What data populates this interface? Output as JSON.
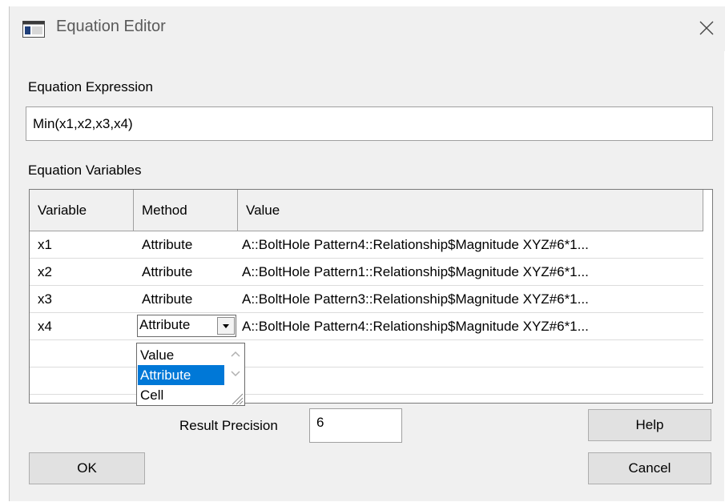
{
  "window": {
    "title": "Equation Editor"
  },
  "expression": {
    "label": "Equation Expression",
    "value": "Min(x1,x2,x3,x4)"
  },
  "variables": {
    "label": "Equation Variables",
    "columns": [
      "Variable",
      "Method",
      "Value"
    ],
    "rows": [
      {
        "variable": "x1",
        "method": "Attribute",
        "value": "A::BoltHole Pattern4::Relationship$Magnitude XYZ#6*1..."
      },
      {
        "variable": "x2",
        "method": "Attribute",
        "value": "A::BoltHole Pattern1::Relationship$Magnitude XYZ#6*1..."
      },
      {
        "variable": "x3",
        "method": "Attribute",
        "value": "A::BoltHole Pattern3::Relationship$Magnitude XYZ#6*1..."
      },
      {
        "variable": "x4",
        "method": "Attribute",
        "value": "A::BoltHole Pattern4::Relationship$Magnitude XYZ#6*1..."
      }
    ],
    "method_options": [
      "Value",
      "Attribute",
      "Cell"
    ],
    "selected_option": "Attribute"
  },
  "precision": {
    "label": "Result Precision",
    "value": "6"
  },
  "buttons": {
    "help": "Help",
    "ok": "OK",
    "cancel": "Cancel"
  },
  "colors": {
    "selection": "#0078d7",
    "dialog_bg": "#f0f0f0"
  }
}
